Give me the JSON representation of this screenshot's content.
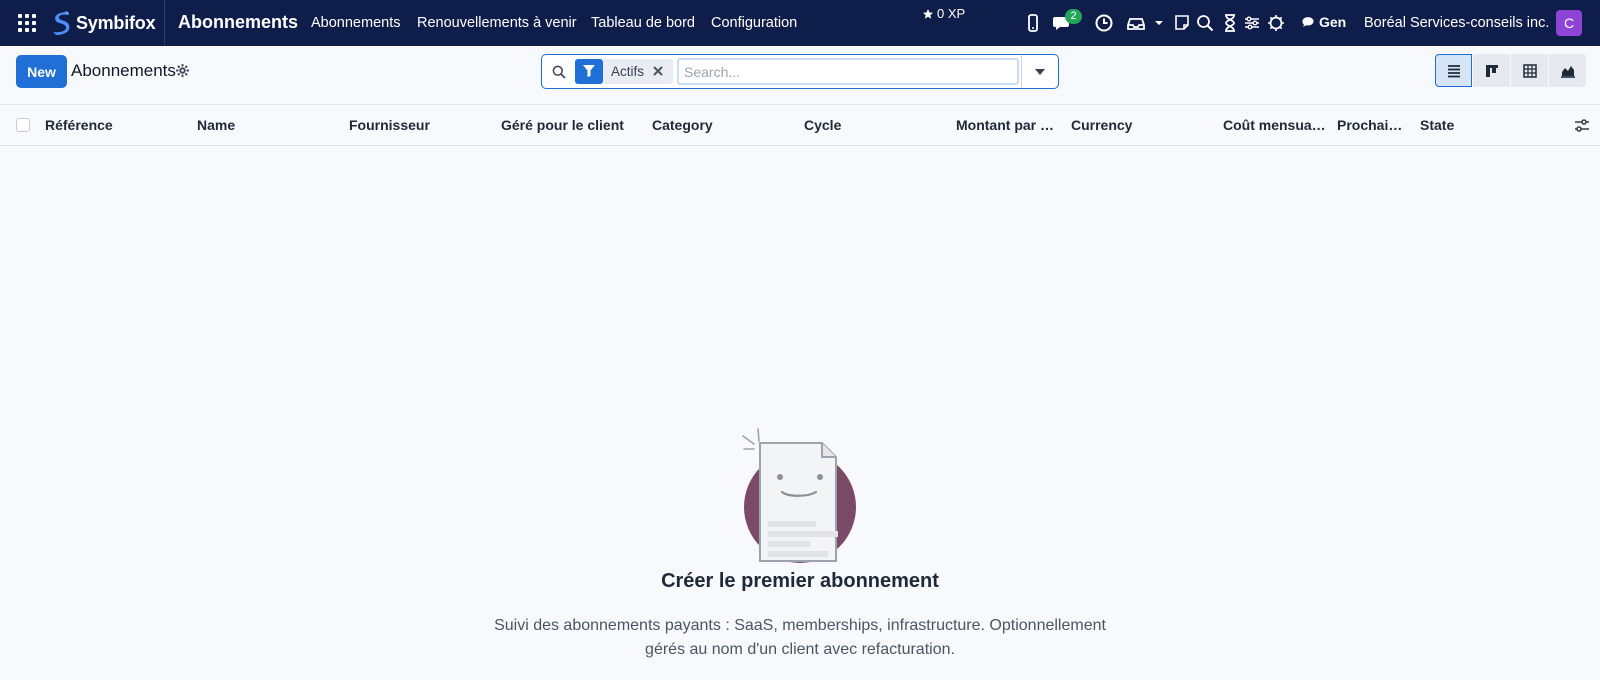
{
  "navbar": {
    "brand": "Symbifox",
    "app_title": "Abonnements",
    "menu": [
      "Abonnements",
      "Renouvellements à venir",
      "Tableau de bord",
      "Configuration"
    ],
    "xp": "0 XP",
    "chat_badge": "2",
    "gen_label": "Gen",
    "company": "Boréal Services-conseils inc.",
    "avatar_initial": "C"
  },
  "control": {
    "new_label": "New",
    "breadcrumb": "Abonnements",
    "search": {
      "facet": "Actifs",
      "placeholder": "Search...",
      "value": ""
    },
    "views": [
      "list-icon",
      "kanban-icon",
      "pivot-icon",
      "graph-icon"
    ],
    "active_view": "list-icon"
  },
  "table": {
    "columns": [
      "Référence",
      "Name",
      "Fournisseur",
      "Géré pour le client",
      "Category",
      "Cycle",
      "Montant par …",
      "Currency",
      "Coût mensua…",
      "Prochai…",
      "State"
    ]
  },
  "empty_state": {
    "title": "Créer le premier abonnement",
    "text": "Suivi des abonnements payants : SaaS, memberships, infrastructure. Optionnellement gérés au nom d'un client avec refacturation."
  },
  "colors": {
    "navbar_bg": "#0f1d4a",
    "primary": "#1f6fd6",
    "badge_green": "#22a559",
    "avatar_purple": "#8e44d6",
    "illustration_circle": "#7b4a66"
  }
}
